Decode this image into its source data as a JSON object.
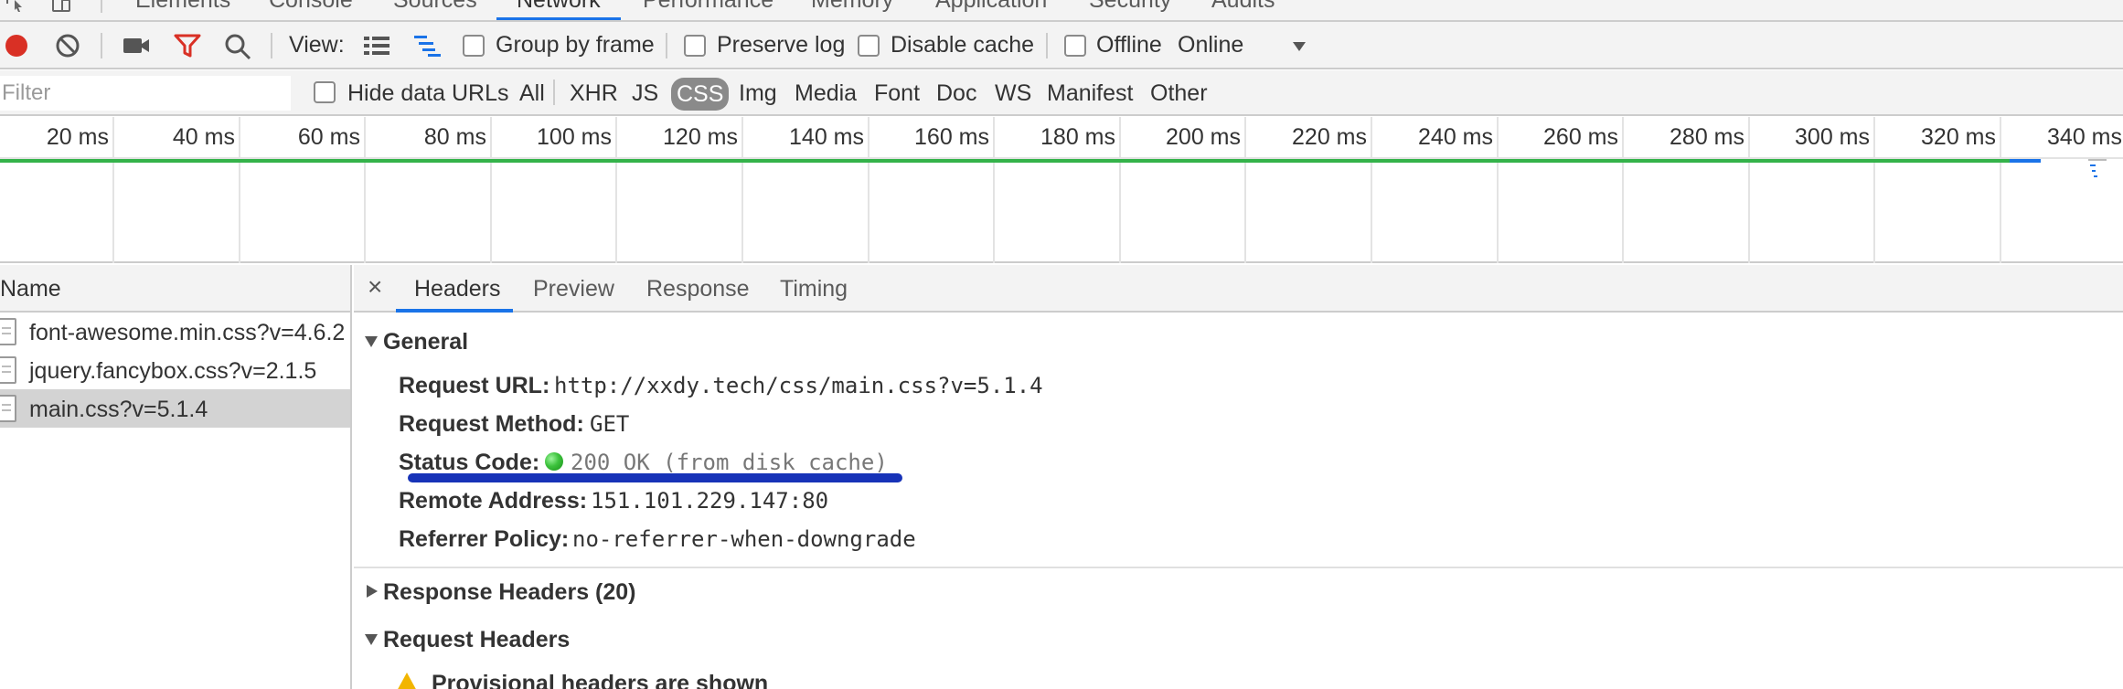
{
  "top_tabs": {
    "items": [
      "Elements",
      "Console",
      "Sources",
      "Network",
      "Performance",
      "Memory",
      "Application",
      "Security",
      "Audits"
    ],
    "active": "Network"
  },
  "toolbar": {
    "view_label": "View:",
    "group_by_frame_label": "Group by frame",
    "preserve_log_label": "Preserve log",
    "disable_cache_label": "Disable cache",
    "offline_label": "Offline",
    "throttle_value": "Online",
    "record_color": "#d93025",
    "filter_icon_color": "#d93025"
  },
  "filter": {
    "placeholder": "Filter",
    "hide_data_urls_label": "Hide data URLs",
    "types": [
      "All",
      "XHR",
      "JS",
      "CSS",
      "Img",
      "Media",
      "Font",
      "Doc",
      "WS",
      "Manifest",
      "Other"
    ],
    "selected_type": "CSS"
  },
  "overview": {
    "ticks": [
      "20 ms",
      "40 ms",
      "60 ms",
      "80 ms",
      "100 ms",
      "120 ms",
      "140 ms",
      "160 ms",
      "180 ms",
      "200 ms",
      "220 ms",
      "240 ms",
      "260 ms",
      "280 ms",
      "300 ms",
      "320 ms",
      "340 ms"
    ],
    "bar_colors": {
      "waiting": "#34b34a",
      "download": "#1a73e8"
    }
  },
  "requests": {
    "column_header": "Name",
    "items": [
      {
        "name": "font-awesome.min.css?v=4.6.2",
        "selected": false
      },
      {
        "name": "jquery.fancybox.css?v=2.1.5",
        "selected": false
      },
      {
        "name": "main.css?v=5.1.4",
        "selected": true
      }
    ]
  },
  "details": {
    "close_label": "×",
    "tabs": [
      "Headers",
      "Preview",
      "Response",
      "Timing"
    ],
    "active_tab": "Headers",
    "general": {
      "title": "General",
      "request_url_key": "Request URL:",
      "request_url": "http://xxdy.tech/css/main.css?v=5.1.4",
      "request_method_key": "Request Method:",
      "request_method": "GET",
      "status_code_key": "Status Code:",
      "status_code": "200 OK (from disk cache)",
      "remote_address_key": "Remote Address:",
      "remote_address": "151.101.229.147:80",
      "referrer_policy_key": "Referrer Policy:",
      "referrer_policy": "no-referrer-when-downgrade"
    },
    "response_headers_title": "Response Headers (20)",
    "request_headers_title": "Request Headers",
    "provisional_warning": "Provisional headers are shown",
    "annotation_color": "#1733b8"
  }
}
